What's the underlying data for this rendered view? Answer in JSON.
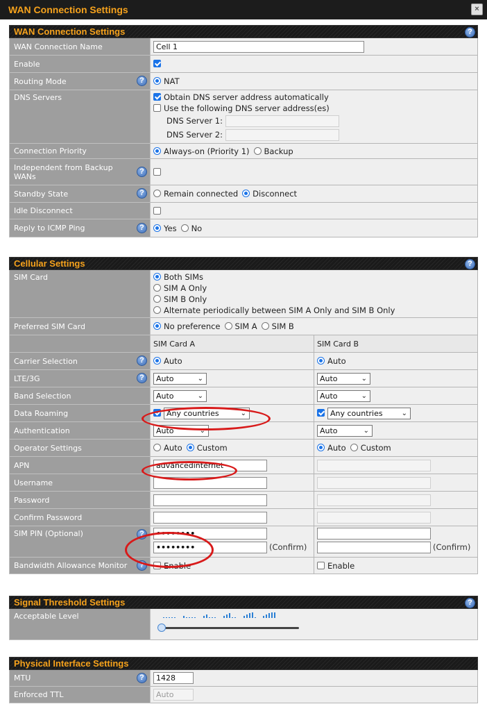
{
  "window": {
    "title": "WAN Connection Settings",
    "close": "×"
  },
  "wan": {
    "header": "WAN Connection Settings",
    "name_label": "WAN Connection Name",
    "name_value": "Cell 1",
    "enable_label": "Enable",
    "routing_label": "Routing Mode",
    "routing_value": "NAT",
    "dns_label": "DNS Servers",
    "dns_auto": "Obtain DNS server address automatically",
    "dns_manual": "Use the following DNS server address(es)",
    "dns1_label": "DNS Server 1:",
    "dns2_label": "DNS Server 2:",
    "priority_label": "Connection Priority",
    "priority_always": "Always-on (Priority 1)",
    "priority_backup": "Backup",
    "independent_label": "Independent from Backup WANs",
    "standby_label": "Standby State",
    "standby_remain": "Remain connected",
    "standby_disconnect": "Disconnect",
    "idle_label": "Idle Disconnect",
    "icmp_label": "Reply to ICMP Ping",
    "icmp_yes": "Yes",
    "icmp_no": "No"
  },
  "cellular": {
    "header": "Cellular Settings",
    "sim_label": "SIM Card",
    "sim_options": [
      "Both SIMs",
      "SIM A Only",
      "SIM B Only",
      "Alternate periodically between SIM A Only and SIM B Only"
    ],
    "pref_label": "Preferred SIM Card",
    "pref_none": "No preference",
    "pref_a": "SIM A",
    "pref_b": "SIM B",
    "col_a": "SIM Card A",
    "col_b": "SIM Card B",
    "carrier_label": "Carrier Selection",
    "carrier_value": "Auto",
    "lte_label": "LTE/3G",
    "lte_value": "Auto",
    "band_label": "Band Selection",
    "band_value": "Auto",
    "roaming_label": "Data Roaming",
    "roaming_value": "Any countries",
    "auth_label": "Authentication",
    "auth_value": "Auto",
    "operator_label": "Operator Settings",
    "operator_auto": "Auto",
    "operator_custom": "Custom",
    "apn_label": "APN",
    "apn_a": "advancedinternet",
    "username_label": "Username",
    "password_label": "Password",
    "confirm_label": "Confirm Password",
    "pin_label": "SIM PIN (Optional)",
    "pin_a1": "••••••••",
    "pin_a2": "••••••••",
    "confirm_text": "(Confirm)",
    "bw_label": "Bandwidth Allowance Monitor",
    "bw_enable": "Enable"
  },
  "signal": {
    "header": "Signal Threshold Settings",
    "level_label": "Acceptable Level",
    "level_value": 0
  },
  "physical": {
    "header": "Physical Interface Settings",
    "mtu_label": "MTU",
    "mtu_value": "1428",
    "ttl_label": "Enforced TTL",
    "ttl_placeholder": "Auto"
  },
  "colors": {
    "accent": "#f6a21c",
    "label_bg": "#9e9e9e",
    "highlight": "#d81a1a",
    "check": "#1a73e8"
  }
}
